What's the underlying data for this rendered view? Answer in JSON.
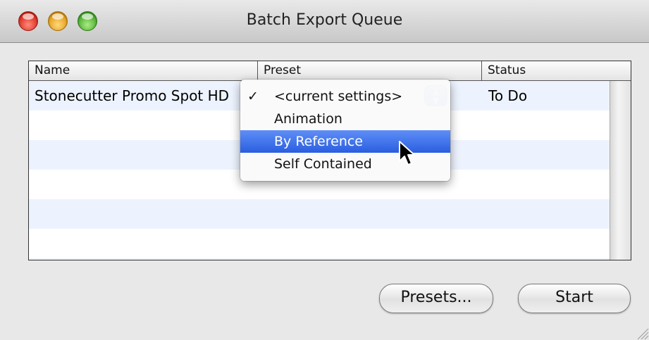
{
  "window": {
    "title": "Batch Export Queue"
  },
  "table": {
    "columns": [
      "Name",
      "Preset",
      "Status"
    ],
    "rows": [
      {
        "name": "Stonecutter Promo Spot HD",
        "preset": "<current settings>",
        "status": "To Do"
      }
    ]
  },
  "preset_menu": {
    "items": [
      {
        "label": "<current settings>",
        "checked": true,
        "check": "✓"
      },
      {
        "label": "Animation"
      },
      {
        "label": "By Reference",
        "highlighted": true
      },
      {
        "label": "Self Contained"
      }
    ]
  },
  "buttons": {
    "presets": "Presets...",
    "start": "Start"
  },
  "colors": {
    "highlight": "#2a5ee0",
    "row_stripe": "#edf3fe"
  }
}
